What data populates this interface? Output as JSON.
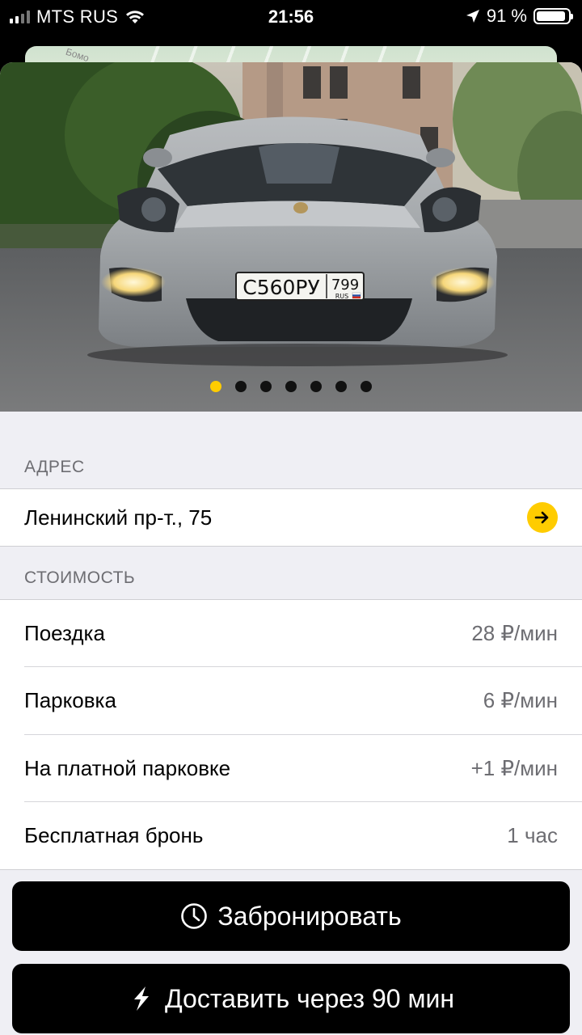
{
  "status_bar": {
    "carrier": "MTS RUS",
    "time": "21:56",
    "battery_percent": "91 %",
    "battery_level": 0.91,
    "signal_bars": 2
  },
  "map": {
    "street_fragment": "Бомо"
  },
  "photo": {
    "plate_main": "С560РУ",
    "plate_region": "799",
    "plate_country": "RUS",
    "slide_count": 7,
    "active_slide": 0
  },
  "address_section": {
    "header": "АДРЕС",
    "address": "Ленинский пр-т., 75"
  },
  "cost_section": {
    "header": "СТОИМОСТЬ",
    "rows": [
      {
        "label": "Поездка",
        "value": "28 ₽/мин"
      },
      {
        "label": "Парковка",
        "value": "6 ₽/мин"
      },
      {
        "label": "На платной парковке",
        "value": "+1 ₽/мин"
      },
      {
        "label": "Бесплатная бронь",
        "value": "1 час"
      }
    ]
  },
  "actions": {
    "book_label": "Забронировать",
    "deliver_label": "Доставить через 90 мин"
  },
  "colors": {
    "accent": "#ffcc00",
    "background": "#efeff4",
    "button": "#000000",
    "secondary_text": "#6d6d72"
  },
  "icons": {
    "book": "clock-icon",
    "deliver": "lightning-icon",
    "navigate": "arrow-right-icon",
    "location": "location-arrow-icon",
    "wifi": "wifi-icon"
  }
}
